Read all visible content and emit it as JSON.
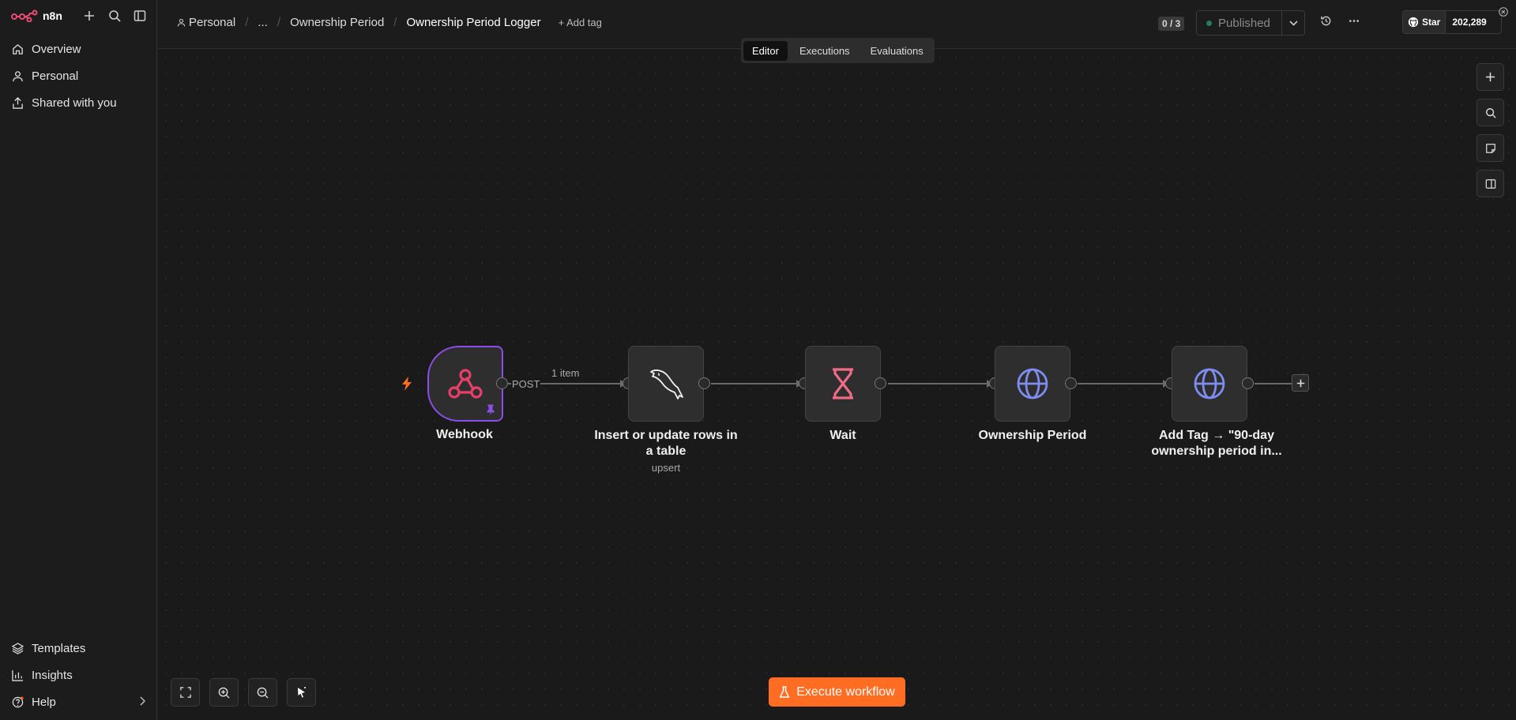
{
  "app": {
    "name": "n8n"
  },
  "sidebar": {
    "items": [
      {
        "label": "Overview",
        "icon": "home-icon"
      },
      {
        "label": "Personal",
        "icon": "user-icon"
      },
      {
        "label": "Shared with you",
        "icon": "share-icon"
      }
    ],
    "bottom": [
      {
        "label": "Templates",
        "icon": "layers-icon"
      },
      {
        "label": "Insights",
        "icon": "bar-chart-icon"
      },
      {
        "label": "Help",
        "icon": "help-icon"
      }
    ]
  },
  "header": {
    "breadcrumbs": [
      "Personal",
      "...",
      "Ownership Period",
      "Ownership Period Logger"
    ],
    "add_tag": "+ Add tag",
    "counter": "0 / 3",
    "published": "Published",
    "github": {
      "star": "Star",
      "count": "202,289"
    }
  },
  "tabs": [
    "Editor",
    "Executions",
    "Evaluations"
  ],
  "nodes": [
    {
      "label": "Webhook",
      "type": "webhook"
    },
    {
      "label": "Insert or update rows in a table",
      "sub": "upsert",
      "type": "mysql"
    },
    {
      "label": "Wait",
      "type": "wait"
    },
    {
      "label": "Ownership Period",
      "type": "http"
    },
    {
      "label": "Add Tag → \"90-day ownership period in...",
      "type": "http"
    }
  ],
  "edges": {
    "webhook_output": "POST",
    "items": "1 item"
  },
  "execute_button": "Execute workflow",
  "colors": {
    "accent": "#ff6d23",
    "trigger_border": "#8d4de8",
    "webhook": "#e83e6a",
    "http": "#7f8cf0",
    "wait": "#f06b85"
  }
}
